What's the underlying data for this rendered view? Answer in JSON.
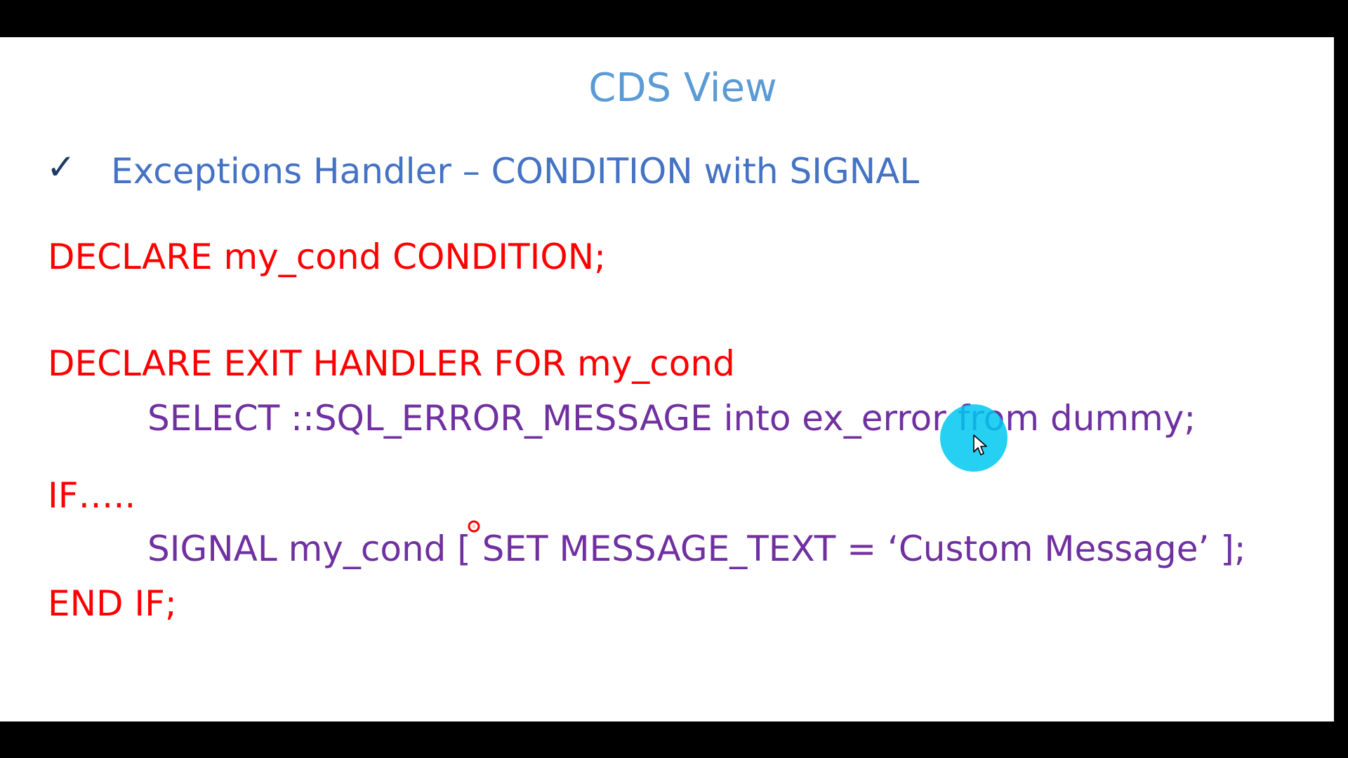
{
  "slide": {
    "title": "CDS View",
    "bullet": {
      "icon": "check-icon",
      "text": "Exceptions Handler – CONDITION with SIGNAL"
    },
    "code_lines": [
      "DECLARE my_cond CONDITION;",
      "DECLARE EXIT HANDLER FOR my_cond",
      "SELECT  ::SQL_ERROR_MESSAGE into ex_error from dummy;",
      "IF…..",
      "SIGNAL my_cond [ SET MESSAGE_TEXT = ‘Custom Message’ ];",
      "END IF;"
    ]
  },
  "colors": {
    "title": "#5b9bd5",
    "bullet_text": "#4472c4",
    "keyword_red": "#ff0000",
    "body_purple": "#7030a0",
    "cursor_highlight": "#00c8f0",
    "laser": "#ff0000"
  },
  "icons": {
    "cursor": "mouse-pointer-icon",
    "laser": "laser-pointer-icon"
  }
}
